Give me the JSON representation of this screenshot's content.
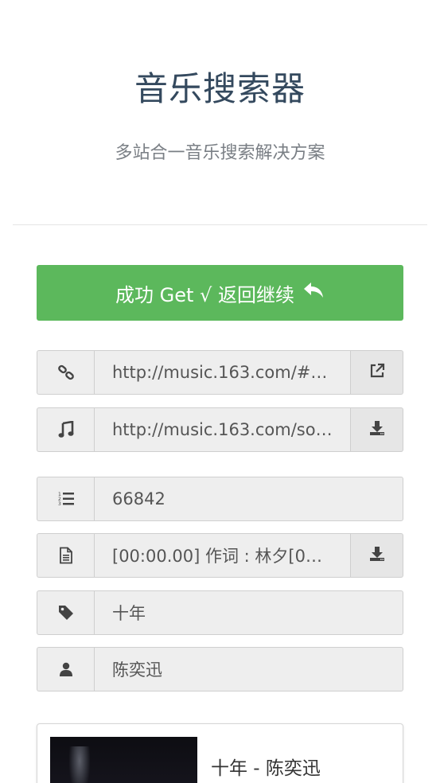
{
  "header": {
    "title": "音乐搜索器",
    "subtitle": "多站合一音乐搜索解决方案"
  },
  "success_button": {
    "label": "成功 Get √ 返回继续",
    "icon": "reply-icon",
    "color": "#5cb85c"
  },
  "fields": {
    "song_link": {
      "icon": "link-icon",
      "value": "http://music.163.com/#/so…",
      "action_icon": "external-link-icon"
    },
    "audio_url": {
      "icon": "music-icon",
      "value": "http://music.163.com/song…",
      "action_icon": "download-icon"
    },
    "song_id": {
      "icon": "ordered-list-icon",
      "value": "66842"
    },
    "lyrics": {
      "icon": "file-text-icon",
      "value": "[00:00.00] 作词 : 林夕[00:01…",
      "action_icon": "download-icon"
    },
    "song_title": {
      "icon": "tag-icon",
      "value": "十年"
    },
    "artist": {
      "icon": "user-icon",
      "value": "陈奕迅"
    }
  },
  "player_card": {
    "title": "十年 - 陈奕迅"
  }
}
